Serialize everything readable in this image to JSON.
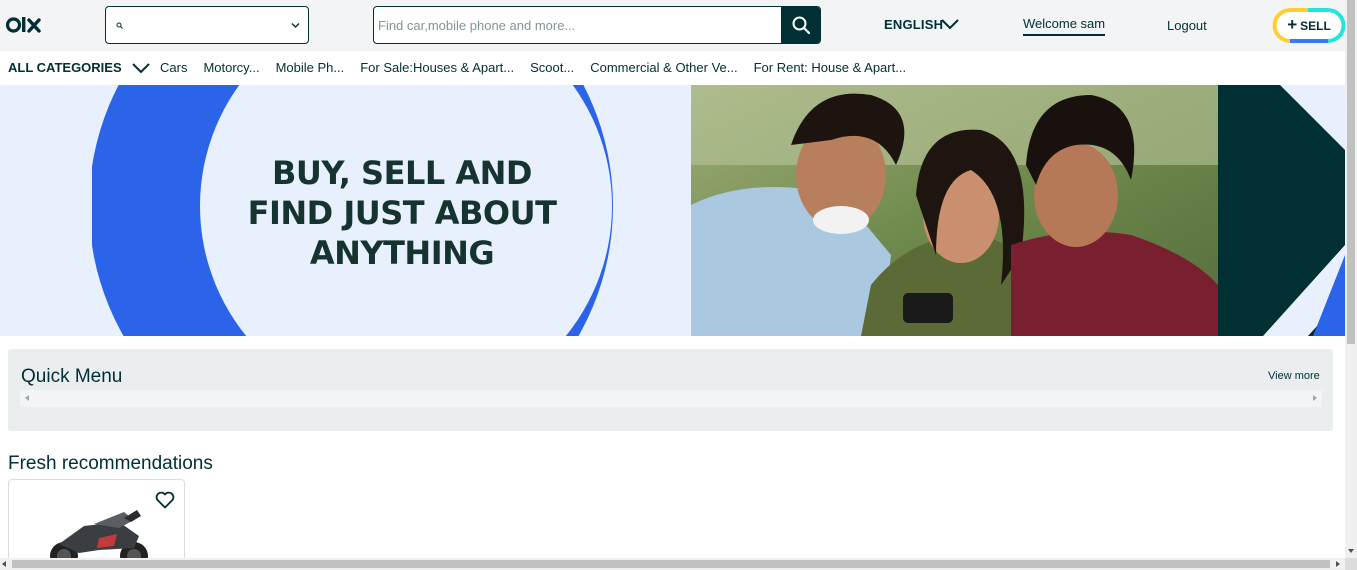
{
  "header": {
    "logo_icon": "olx-logo",
    "location": {
      "value": "",
      "icon": "search-icon"
    },
    "search": {
      "placeholder": "Find car,mobile phone and more...",
      "value": "",
      "button_icon": "search-icon"
    },
    "language": "ENGLISH",
    "welcome": "Welcome sam",
    "logout": "Logout",
    "sell": {
      "plus": "+",
      "label": "SELL"
    }
  },
  "categories": {
    "all_label": "ALL CATEGORIES",
    "items": [
      "Cars",
      "Motorcy...",
      "Mobile Ph...",
      "For Sale:Houses & Apart...",
      "Scoot...",
      "Commercial & Other Ve...",
      "For Rent: House & Apart..."
    ]
  },
  "banner": {
    "headline_line1": "BUY, SELL AND",
    "headline_line2": "FIND JUST ABOUT",
    "headline_line3": "ANYTHING"
  },
  "quick_menu": {
    "title": "Quick Menu",
    "view_more": "View more"
  },
  "recommendations": {
    "title": "Fresh recommendations",
    "items": [
      {
        "image": "motorcycle",
        "favorite_icon": "heart-icon"
      }
    ]
  },
  "colors": {
    "primary": "#002f34",
    "header_bg": "#f2f4f5",
    "banner_blue": "#2b64e8",
    "banner_light": "#e8f0fd",
    "sell_yellow": "#ffce32",
    "sell_blue": "#3a77ff",
    "sell_teal": "#23e5db"
  }
}
